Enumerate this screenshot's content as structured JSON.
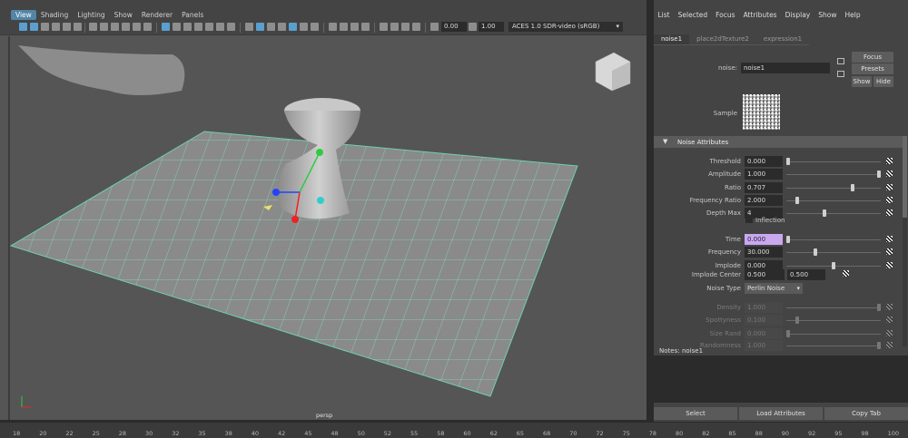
{
  "viewport": {
    "menus": [
      "View",
      "Shading",
      "Lighting",
      "Show",
      "Renderer",
      "Panels"
    ],
    "active_menu": "View",
    "toolbar": {
      "field1": "0.00",
      "field2": "1.00",
      "colorspace": "ACES 1.0 SDR-video (sRGB)"
    },
    "camera_label": "persp"
  },
  "timeline": {
    "ticks": [
      "18",
      "20",
      "22",
      "25",
      "28",
      "30",
      "32",
      "35",
      "38",
      "40",
      "42",
      "45",
      "48",
      "50",
      "52",
      "55",
      "58",
      "60",
      "62",
      "65",
      "68",
      "70",
      "72",
      "75",
      "78",
      "80",
      "82",
      "85",
      "88",
      "90",
      "92",
      "95",
      "98",
      "100"
    ]
  },
  "attribute_editor": {
    "menus": [
      "List",
      "Selected",
      "Focus",
      "Attributes",
      "Display",
      "Show",
      "Help"
    ],
    "tabs": [
      "noise1",
      "place2dTexture2",
      "expression1"
    ],
    "active_tab": "noise1",
    "node_label": "noise:",
    "node_name": "noise1",
    "focus_label": "Focus",
    "presets_label": "Presets",
    "show_label": "Show",
    "hide_label": "Hide",
    "sample_label": "Sample",
    "section_title": "Noise Attributes",
    "attributes": [
      {
        "label": "Threshold",
        "value": "0.000",
        "slider": 0.0,
        "dim": false
      },
      {
        "label": "Amplitude",
        "value": "1.000",
        "slider": 1.0,
        "dim": false
      },
      {
        "label": "Ratio",
        "value": "0.707",
        "slider": 0.707,
        "dim": false
      },
      {
        "label": "Frequency Ratio",
        "value": "2.000",
        "slider": 0.1,
        "dim": false
      },
      {
        "label": "Depth Max",
        "value": "4",
        "slider": 0.4,
        "dim": false
      },
      {
        "label": "Time",
        "value": "0.000",
        "slider": 0.0,
        "dim": false
      },
      {
        "label": "Frequency",
        "value": "30.000",
        "slider": 0.3,
        "dim": false
      },
      {
        "label": "Implode",
        "value": "0.000",
        "slider": 0.5,
        "dim": false
      },
      {
        "label": "Density",
        "value": "1.000",
        "slider": 1.0,
        "dim": true
      },
      {
        "label": "Spottyness",
        "value": "0.100",
        "slider": 0.1,
        "dim": true
      },
      {
        "label": "Size Rand",
        "value": "0.000",
        "slider": 0.0,
        "dim": true
      },
      {
        "label": "Randomness",
        "value": "1.000",
        "slider": 1.0,
        "dim": true
      }
    ],
    "inflection_label": "Inflection",
    "implode_center_label": "Implode Center",
    "implode_center_x": "0.500",
    "implode_center_y": "0.500",
    "noise_type_label": "Noise Type",
    "noise_type_value": "Perlin Noise",
    "notes_label": "Notes:",
    "notes_node": "noise1",
    "buttons": [
      "Select",
      "Load Attributes",
      "Copy Tab"
    ]
  }
}
